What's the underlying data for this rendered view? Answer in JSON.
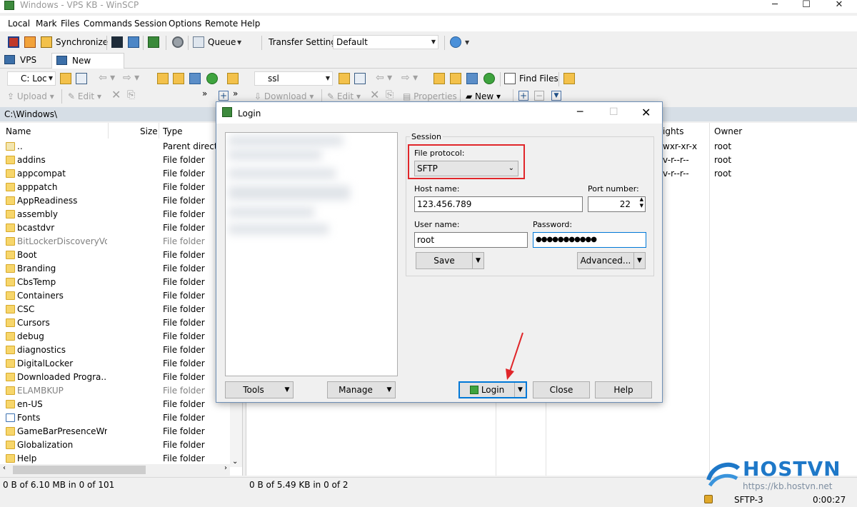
{
  "window": {
    "title": "Windows - VPS KB - WinSCP"
  },
  "menu": [
    "Local",
    "Mark",
    "Files",
    "Commands",
    "Session",
    "Options",
    "Remote",
    "Help"
  ],
  "toolbar": {
    "synchronize": "Synchronize",
    "queue": "Queue",
    "transfer_settings_label": "Transfer Settings",
    "transfer_settings_value": "Default"
  },
  "tabs": [
    "VPS KB",
    "New Session"
  ],
  "left_nav": {
    "drive": "C: Loc",
    "upload": "Upload",
    "edit": "Edit"
  },
  "right_nav": {
    "folder": "ssl",
    "find_files": "Find Files",
    "download": "Download",
    "edit": "Edit",
    "properties": "Properties",
    "new": "New"
  },
  "left_panel": {
    "path": "C:\\Windows\\",
    "columns": [
      "Name",
      "Size",
      "Type"
    ],
    "rows": [
      {
        "name": "..",
        "type": "Parent directo",
        "icon": "parent-dir-icon"
      },
      {
        "name": "addins",
        "type": "File folder"
      },
      {
        "name": "appcompat",
        "type": "File folder"
      },
      {
        "name": "apppatch",
        "type": "File folder"
      },
      {
        "name": "AppReadiness",
        "type": "File folder"
      },
      {
        "name": "assembly",
        "type": "File folder"
      },
      {
        "name": "bcastdvr",
        "type": "File folder"
      },
      {
        "name": "BitLockerDiscoveryVo...",
        "type": "File folder",
        "faded": true
      },
      {
        "name": "Boot",
        "type": "File folder"
      },
      {
        "name": "Branding",
        "type": "File folder"
      },
      {
        "name": "CbsTemp",
        "type": "File folder"
      },
      {
        "name": "Containers",
        "type": "File folder"
      },
      {
        "name": "CSC",
        "type": "File folder"
      },
      {
        "name": "Cursors",
        "type": "File folder"
      },
      {
        "name": "debug",
        "type": "File folder"
      },
      {
        "name": "diagnostics",
        "type": "File folder"
      },
      {
        "name": "DigitalLocker",
        "type": "File folder"
      },
      {
        "name": "Downloaded Progra...",
        "type": "File folder"
      },
      {
        "name": "ELAMBKUP",
        "type": "File folder",
        "faded": true
      },
      {
        "name": "en-US",
        "type": "File folder"
      },
      {
        "name": "Fonts",
        "type": "File folder",
        "icon": "fonts-folder-icon"
      },
      {
        "name": "GameBarPresenceWri",
        "type": "File folder"
      },
      {
        "name": "Globalization",
        "type": "File folder"
      },
      {
        "name": "Help",
        "type": "File folder"
      }
    ],
    "status": "0 B of 6.10 MB in 0 of 101"
  },
  "right_panel": {
    "columns": [
      "ights",
      "Owner"
    ],
    "rows": [
      {
        "rights": "wxr-xr-x",
        "owner": "root"
      },
      {
        "rights": "v-r--r--",
        "owner": "root"
      },
      {
        "rights": "v-r--r--",
        "owner": "root"
      }
    ],
    "status": "0 B of 5.49 KB in 0 of 2"
  },
  "statusbar": {
    "protocol": "SFTP-3",
    "time": "0:00:27"
  },
  "dialog": {
    "title": "Login",
    "session_group": "Session",
    "file_protocol_label": "File protocol:",
    "file_protocol_value": "SFTP",
    "host_label": "Host name:",
    "host_value": "123.456.789",
    "port_label": "Port number:",
    "port_value": "22",
    "user_label": "User name:",
    "user_value": "root",
    "password_label": "Password:",
    "password_value": "●●●●●●●●●●●",
    "save": "Save",
    "advanced": "Advanced...",
    "tools": "Tools",
    "manage": "Manage",
    "login": "Login",
    "close": "Close",
    "help": "Help"
  },
  "watermark": {
    "brand": "HOSTVN",
    "url": "https://kb.hostvn.net"
  },
  "colors": {
    "highlight_red": "#e0262a",
    "accent_blue": "#0078d7",
    "brand_blue": "#1e78c8"
  }
}
